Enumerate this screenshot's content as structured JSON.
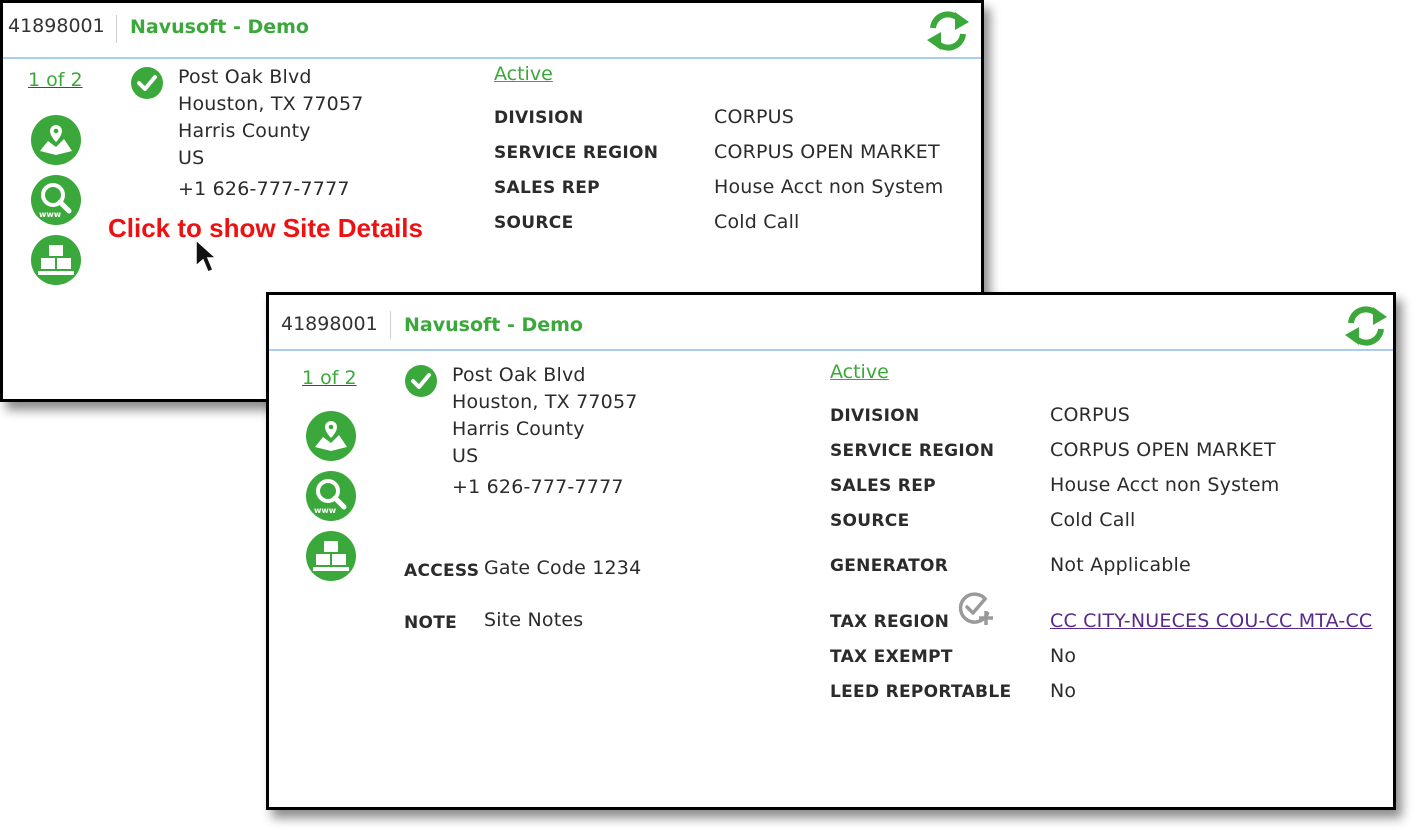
{
  "header": {
    "account_number": "41898001",
    "title": "Navusoft - Demo"
  },
  "pagination": "1 of 2",
  "address": {
    "line1": "Post Oak Blvd",
    "line2": "Houston, TX 77057",
    "county": "Harris County",
    "country": "US",
    "phone": "+1 626-777-7777"
  },
  "status": "Active",
  "details": [
    {
      "label": "DIVISION",
      "value": "CORPUS"
    },
    {
      "label": "SERVICE REGION",
      "value": "CORPUS OPEN MARKET"
    },
    {
      "label": "SALES REP",
      "value": "House Acct non System"
    },
    {
      "label": "SOURCE",
      "value": "Cold Call"
    }
  ],
  "site_details": {
    "access_label": "ACCESS",
    "access_value": "Gate Code 1234",
    "note_label": "NOTE",
    "note_value": "Site Notes",
    "generator_label": "GENERATOR",
    "generator_value": "Not Applicable",
    "tax_region_label": "TAX REGION",
    "tax_region_value": "CC CITY-NUECES COU-CC MTA-CC",
    "tax_exempt_label": "TAX EXEMPT",
    "tax_exempt_value": "No",
    "leed_label": "LEED REPORTABLE",
    "leed_value": "No"
  },
  "annotation": "Click to show Site Details",
  "icons": {
    "refresh": "refresh-icon",
    "check": "check-circle-icon",
    "map": "map-pin-icon",
    "web": "web-search-icon",
    "inventory": "boxes-icon",
    "tax_add": "check-add-icon",
    "cursor": "mouse-pointer-icon"
  },
  "colors": {
    "accent_green": "#3aa83a",
    "link_purple": "#5a2a8a",
    "header_border": "#a9cdef",
    "annotation_red": "#ee1111"
  }
}
